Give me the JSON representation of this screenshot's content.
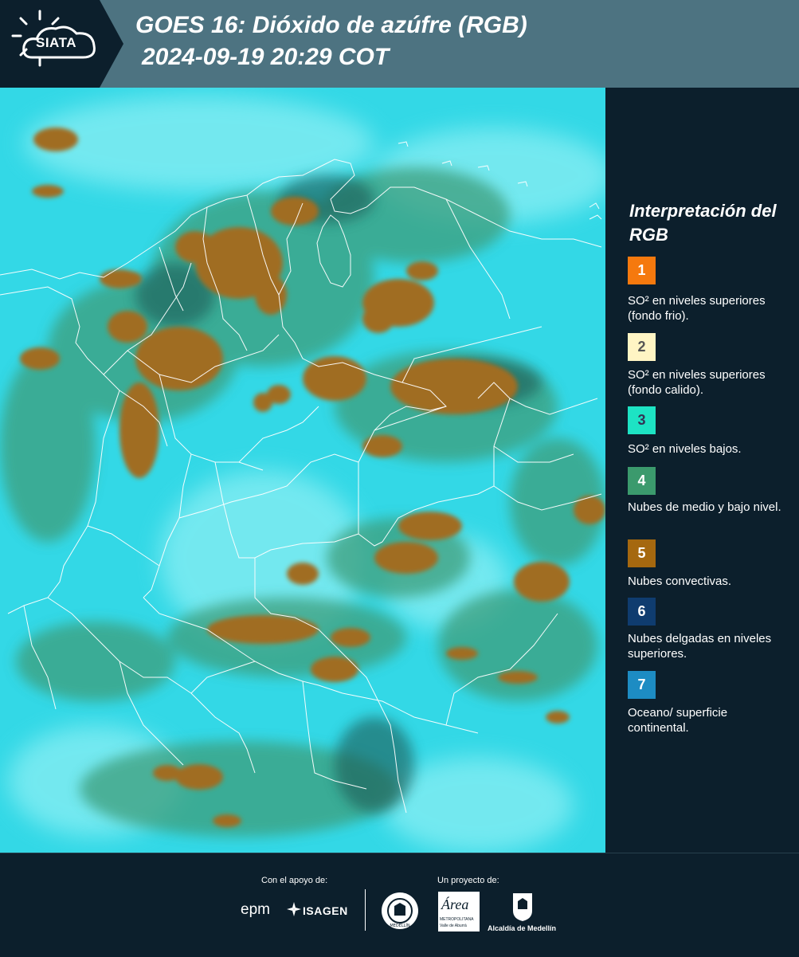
{
  "header": {
    "logo_text": "SIATA",
    "title_line1": "GOES 16: Dióxido de azúfre (RGB)",
    "title_line2": "2024-09-19 20:29 COT"
  },
  "legend": {
    "title": "Interpretación del RGB",
    "items": [
      {
        "number": "1",
        "color": "#f5790e",
        "text": "SO² en niveles superiores (fondo frio)."
      },
      {
        "number": "2",
        "color": "#fff5c4",
        "text": "SO² en niveles superiores (fondo calido)."
      },
      {
        "number": "3",
        "color": "#1de3c4",
        "text": "SO² en niveles bajos."
      },
      {
        "number": "4",
        "color": "#3b9a6d",
        "text": "Nubes de medio y bajo nivel."
      },
      {
        "number": "5",
        "color": "#a5680f",
        "text": "Nubes convectivas."
      },
      {
        "number": "6",
        "color": "#0f3c6f",
        "text": "Nubes delgadas en niveles superiores."
      },
      {
        "number": "7",
        "color": "#1d8cc3",
        "text": "Oceano/ superficie continental."
      }
    ]
  },
  "footer": {
    "support_label": "Con el apoyo de:",
    "project_label": "Un proyecto de:",
    "sponsor_epm": "epm",
    "sponsor_isagen": "ISAGEN",
    "area_logo_text": "Área",
    "area_logo_sub": "METROPOLITANA",
    "area_logo_sub2": "Valle de Aburrá",
    "seal_ring_text": "MEDELLÍN",
    "alcaldia_label": "Alcaldía de Medellín"
  },
  "colors": {
    "header_bg": "#4d7381",
    "panel_bg": "#0c1f2c",
    "map_base": "#30d6e3",
    "convective_cloud": "#a5680f"
  }
}
